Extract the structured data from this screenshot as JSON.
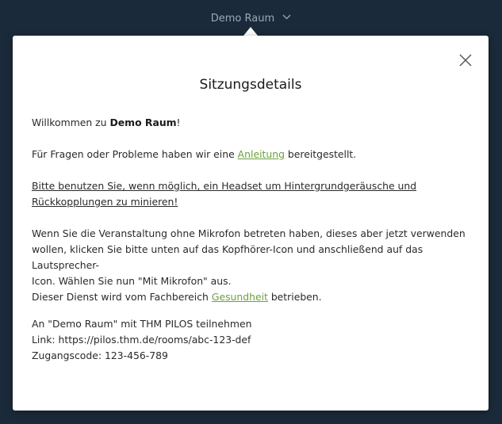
{
  "header": {
    "room_name": "Demo Raum"
  },
  "modal": {
    "title": "Sitzungsdetails",
    "welcome_prefix": "Willkommen zu ",
    "welcome_room": "Demo Raum",
    "welcome_suffix": "!",
    "questions_prefix": "Für Fragen oder Probleme haben wir eine ",
    "questions_link": "Anleitung",
    "questions_suffix": " bereitgestellt.",
    "headset_line1": "Bitte benutzen Sie, wenn möglich, ein Headset um Hintergrundgeräusche und",
    "headset_line2": "Rückkopplungen zu minieren!",
    "mic_line1": "Wenn Sie die Veranstaltung ohne Mikrofon betreten haben, dieses aber jetzt verwenden",
    "mic_line2": "wollen, klicken Sie bitte unten auf das Kopfhörer-Icon und anschließend auf das Lautsprecher-",
    "mic_line3": "Icon. Wählen Sie nun \"Mit Mikrofon\" aus.",
    "service_prefix": "Dieser Dienst wird vom Fachbereich ",
    "service_link": "Gesundheit",
    "service_suffix": " betrieben.",
    "info_line1": "An \"Demo Raum\" mit THM PILOS teilnehmen",
    "info_line2": "Link: https://pilos.thm.de/rooms/abc-123-def",
    "info_line3": "Zugangscode: 123-456-789"
  },
  "icons": {
    "close": "close-icon",
    "chevron": "chevron-down-icon"
  },
  "colors": {
    "background": "#1b2a3a",
    "link": "#6aa23a",
    "header_text": "#9aa8b6"
  }
}
